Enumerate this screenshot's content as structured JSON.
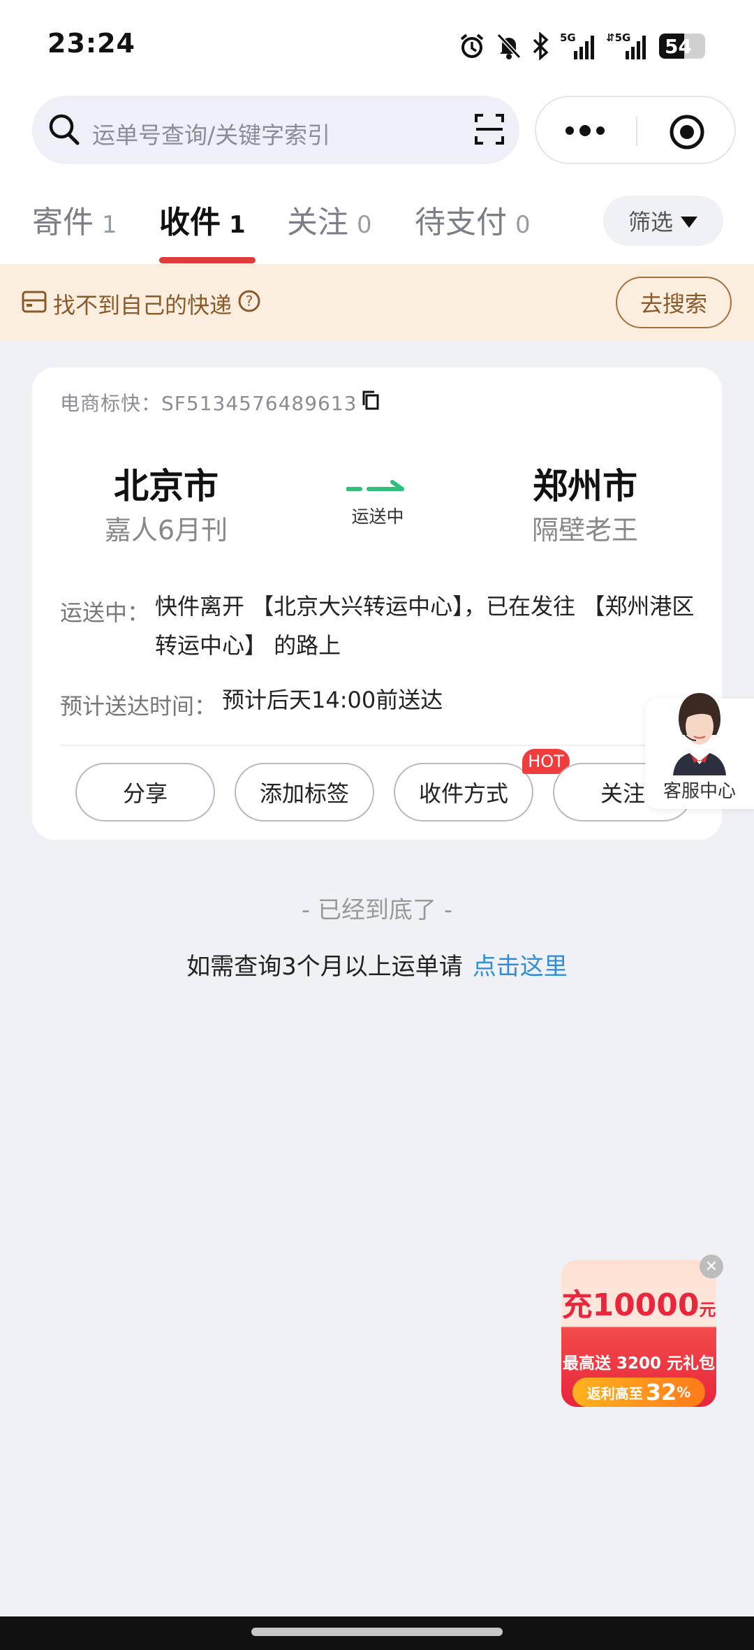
{
  "status_bar": {
    "time": "23:24",
    "battery_level": "54",
    "battery_fraction": 0.54,
    "network": [
      "5G",
      "5G"
    ]
  },
  "search": {
    "placeholder": "运单号查询/关键字索引"
  },
  "tabs": [
    {
      "label": "寄件",
      "count": "1",
      "active": false
    },
    {
      "label": "收件",
      "count": "1",
      "active": true
    },
    {
      "label": "关注",
      "count": "0",
      "active": false
    },
    {
      "label": "待支付",
      "count": "0",
      "active": false
    }
  ],
  "filter_label": "筛选",
  "banner": {
    "text": "找不到自己的快递",
    "button": "去搜索"
  },
  "package": {
    "waybill": "电商标快：SF5134576489613",
    "from_city": "北京市",
    "from_person": "嘉人6月刊",
    "to_city": "郑州市",
    "to_person": "隔壁老王",
    "status_short": "运送中",
    "detail_label": "运送中：",
    "detail_text": "快件离开 【北京大兴转运中心】，已在发往 【郑州港区转运中心】 的路上",
    "eta_label": "预计送达时间：",
    "eta_text": "预计后天14:00前送达",
    "actions": [
      "分享",
      "添加标签",
      "收件方式",
      "关注"
    ],
    "hot_badge": "HOT"
  },
  "service_label": "客服中心",
  "bottom_note": "- 已经到底了 -",
  "more_note": {
    "text": "如需查询3个月以上运单请",
    "link": "点击这里"
  },
  "promo": {
    "title": "充10000",
    "title_unit": "元",
    "subtitle": "最高送 3200 元礼包",
    "rebate_label": "返利高至",
    "rebate_value": "32",
    "rebate_unit": "%"
  },
  "colors": {
    "accent_red": "#e03a3a",
    "link_blue": "#2f8ed9",
    "banner_bg": "#fbeede",
    "transit_green": "#2ec07a"
  }
}
